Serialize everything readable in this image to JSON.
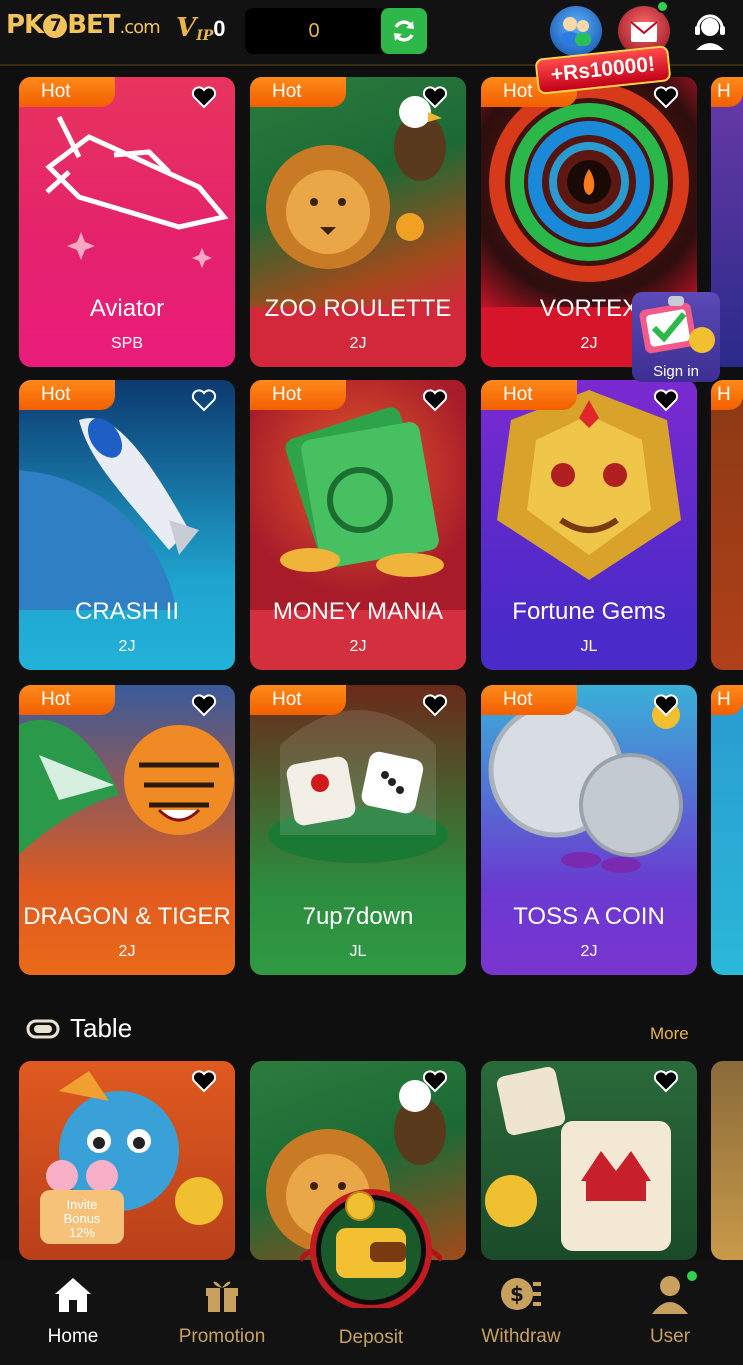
{
  "header": {
    "logo_pk": "PK",
    "logo_seven": "7",
    "logo_bet": "BET",
    "logo_com": ".com",
    "vip_v": "V",
    "vip_ip": "IP",
    "vip_level": "0",
    "balance": "0",
    "promo_badge": "+Rs10000!"
  },
  "colors": {
    "accent": "#e9b54a",
    "hot": "#f25f00",
    "refresh": "#2eb84a",
    "online": "#32d14b"
  },
  "games": [
    {
      "name": "Aviator",
      "provider": "SPB",
      "hot": "Hot"
    },
    {
      "name": "ZOO ROULETTE",
      "provider": "2J",
      "hot": "Hot"
    },
    {
      "name": "VORTEX",
      "provider": "2J",
      "hot": "Hot"
    },
    {
      "name": "CRASH II",
      "provider": "2J",
      "hot": "Hot"
    },
    {
      "name": "MONEY MANIA",
      "provider": "2J",
      "hot": "Hot"
    },
    {
      "name": "Fortune Gems",
      "provider": "JL",
      "hot": "Hot"
    },
    {
      "name": "DRAGON & TIGER",
      "provider": "2J",
      "hot": "Hot"
    },
    {
      "name": "7up7down",
      "provider": "JL",
      "hot": "Hot"
    },
    {
      "name": "TOSS A COIN",
      "provider": "2J",
      "hot": "Hot"
    }
  ],
  "table_section": {
    "title": "Table",
    "more": "More"
  },
  "floating": {
    "sign_in": "Sign in",
    "invite_line1": "Invite",
    "invite_line2": "Bonus",
    "invite_pct": "12%"
  },
  "nav": {
    "home": "Home",
    "promotion": "Promotion",
    "deposit": "Deposit",
    "withdraw": "Withdraw",
    "user": "User"
  }
}
